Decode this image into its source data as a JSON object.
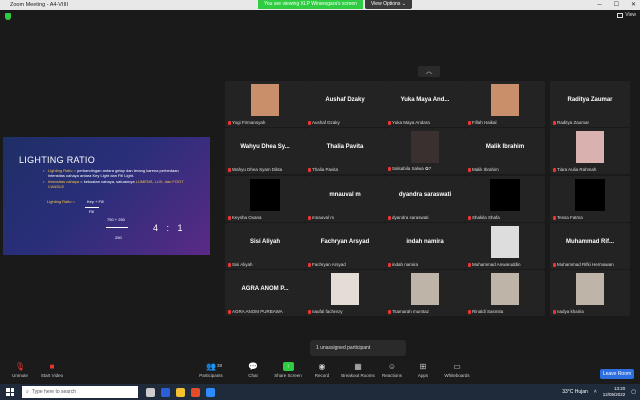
{
  "window": {
    "title": "Zoom Meeting - A4-VIIII",
    "min": "─",
    "max": "☐",
    "close": "✕"
  },
  "banner": {
    "viewing": "You are viewing XLP Wiranegara's screen",
    "view_options": "View Options ⌄"
  },
  "view_button": {
    "label": "View"
  },
  "slide": {
    "title": "LIGHTING RATIO",
    "bullet1_hl": "Lighting Ratio =",
    "bullet1": " perbandingan antara gelap dan terang karena perbedaan intensitas cahaya antara Key Light dan Fill Light.",
    "bullet2_hl": "Intensitas cahaya",
    "bullet2": " = kekuatan cahaya, satuannya ",
    "bullet2_units": "LUMENS, LUX, dan FOOT CANDLE",
    "bullet3_hl": "Lighting Ratio =",
    "bullet3_num": "Key + Fill",
    "bullet3_den": "Fill",
    "calc_top": "750 + 250",
    "calc_bot": "250",
    "ratio": "4 : 1"
  },
  "participants": [
    {
      "display": "",
      "label": "Yogi Firmansyah",
      "video": "warm"
    },
    {
      "display": "Aushaf Dzaky",
      "label": "Aushaf Dzaky",
      "video": ""
    },
    {
      "display": "Yuka Maya And...",
      "label": "Yuka Maya Andara",
      "video": ""
    },
    {
      "display": "",
      "label": "Fillah Haikal",
      "video": "warm"
    },
    {
      "display": "Raditya Zaumar",
      "label": "Raditya Zaumar",
      "video": ""
    },
    {
      "display": "Wahyu Dhea Sy...",
      "label": "Wahyu Dhea Syam Dikta",
      "video": ""
    },
    {
      "display": "Thalia Pavita",
      "label": "Thalia Pavita",
      "video": ""
    },
    {
      "display": "",
      "label": "Salsabila Salwa ✿7",
      "video": "dark"
    },
    {
      "display": "Malik Ibrahim",
      "label": "Malik Ibrahim",
      "video": ""
    },
    {
      "display": "",
      "label": "Tiara Aulia Rahmah",
      "video": "pink"
    },
    {
      "display": "",
      "label": "Keysha Oxana",
      "video": "black"
    },
    {
      "display": "mnauval m",
      "label": "mnauval m",
      "video": ""
    },
    {
      "display": "dyandra saraswati",
      "label": "dyandra saraswati",
      "video": ""
    },
    {
      "display": "",
      "label": "Shakila Shafa",
      "video": "black"
    },
    {
      "display": "",
      "label": "Tessa Fatma",
      "video": "black"
    },
    {
      "display": "Sisi Aliyah",
      "label": "Sisi Aliyah",
      "video": ""
    },
    {
      "display": "Fachryan Arsyad",
      "label": "Fachryan Arsyad",
      "video": ""
    },
    {
      "display": "indah namira",
      "label": "indah namira",
      "video": ""
    },
    {
      "display": "",
      "label": "Muhammad Anwaruddin",
      "video": "logo"
    },
    {
      "display": "Muhammad Rif...",
      "label": "Muhammad Rifki Hermawan",
      "video": ""
    },
    {
      "display": "AGRA ANOM P...",
      "label": "AGRA ANOM PURBAWA",
      "video": ""
    },
    {
      "display": "",
      "label": "naufal fachrezy",
      "video": "wall"
    },
    {
      "display": "",
      "label": "Tsamarah mumtaz",
      "video": "light"
    },
    {
      "display": "",
      "label": "Rinaldi Sasmita",
      "video": "light"
    },
    {
      "display": "",
      "label": "nadya khairia",
      "video": "light"
    }
  ],
  "popup": {
    "text": "1 unassigned participant"
  },
  "toolbar": {
    "unmute": "Unmute",
    "start_video": "Start Video",
    "participants": "Participants",
    "participants_count": "38",
    "chat": "Chat",
    "share": "Share Screen",
    "record": "Record",
    "breakout": "Breakout Rooms",
    "reactions": "Reactions",
    "apps": "Apps",
    "whiteboards": "Whiteboards",
    "leave": "Leave Room"
  },
  "taskbar": {
    "search_placeholder": "Type here to search",
    "weather": "33°C  Hujan",
    "time": "13:20",
    "date": "12/05/2022"
  },
  "colors": {
    "accent_green": "#2ecc40",
    "leave_blue": "#2d6fe0",
    "slide_bg": "#2a2e7a"
  }
}
